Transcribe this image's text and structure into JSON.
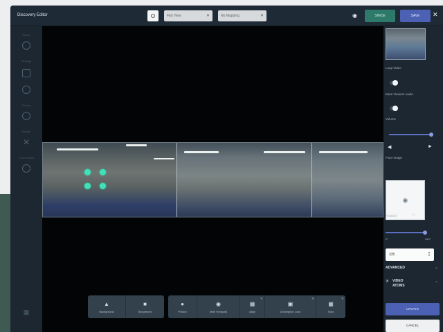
{
  "window": {
    "title": "Discovery Editor"
  },
  "topbar": {
    "view_select": "Flat View",
    "mapping_select": "No Mapping",
    "since_label": "SINCE",
    "save_label": "SAVE"
  },
  "left_sidebar": {
    "groups": [
      "Scene",
      "Settings",
      "Sensor",
      "Rotate",
      "Connections"
    ]
  },
  "toolbar": {
    "group1": [
      {
        "icon": "mountain-icon",
        "label": "Background"
      },
      {
        "icon": "comment-icon",
        "label": "Sequences"
      }
    ],
    "group2": [
      {
        "icon": "person-icon",
        "label": "Pullout"
      },
      {
        "icon": "eye-icon",
        "label": "Multi Hotspots"
      },
      {
        "icon": "align-icon",
        "label": "Align"
      },
      {
        "icon": "window-icon",
        "label": "Description Lock"
      },
      {
        "icon": "grid-icon",
        "label": "Scan"
      }
    ]
  },
  "right_panel": {
    "loop_label": "Loop Video",
    "more_views_label": "More Viewers Audio",
    "volume_label": "Volume",
    "floor_plan_label": "Floor Image",
    "rotation_label": "Rotation",
    "range_min": "0°",
    "range_max": "360°",
    "rotation_value": "335",
    "advanced_label": "ADVANCED",
    "video_atoms_label": "VIDEO ATOMS",
    "update_label": "UPDATE",
    "cancel_label": "CANCEL"
  },
  "colors": {
    "save": "#4d61b4",
    "since": "#2e7a6a",
    "hotspot": "#40e0b8",
    "panel_bg": "#1c2731"
  }
}
